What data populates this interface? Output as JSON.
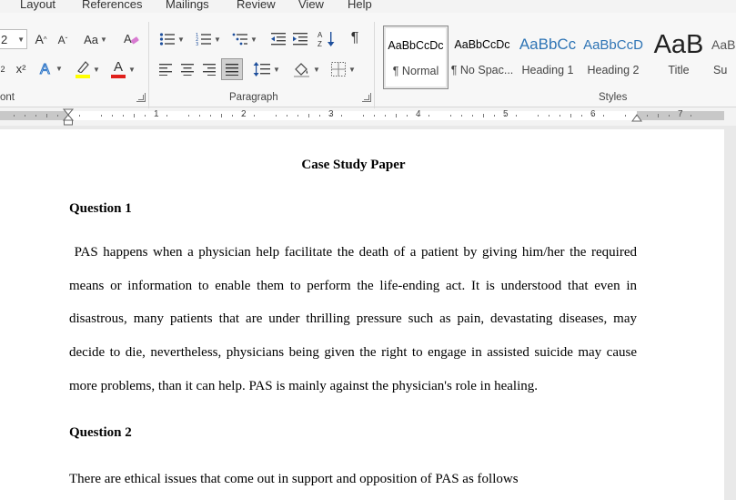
{
  "menu": {
    "tabs": [
      "Layout",
      "References",
      "Mailings",
      "Review",
      "View",
      "Help"
    ]
  },
  "ribbon": {
    "font": {
      "size_value": "2",
      "label": "ont",
      "grow": "A",
      "shrink": "A",
      "change_case": "Aa",
      "subscript": "2",
      "superscript": "x²",
      "font_color_letter": "A",
      "highlight_color": "#ffff00",
      "font_color": "#e0201b"
    },
    "paragraph": {
      "label": "Paragraph",
      "show_marks": "¶"
    },
    "styles": {
      "label": "Styles",
      "items": [
        {
          "sample": "AaBbCcDc",
          "name": "¶ Normal"
        },
        {
          "sample": "AaBbCcDc",
          "name": "¶ No Spac..."
        },
        {
          "sample": "AaBbCc",
          "name": "Heading 1"
        },
        {
          "sample": "AaBbCcD",
          "name": "Heading 2"
        },
        {
          "sample": "AaB",
          "name": "Title"
        },
        {
          "sample": "AaB",
          "name": "Su"
        }
      ]
    }
  },
  "ruler": {
    "numbers": [
      "1",
      "2",
      "3",
      "4",
      "5",
      "6",
      "7"
    ]
  },
  "document": {
    "title": "Case Study Paper",
    "q1_heading": "Question 1",
    "q1_lines": [
      " PAS happens when a physician help facilitate the death of a patient by giving him/her the required",
      "means or information to enable them to perform the life-ending act. It is understood that even in",
      "disastrous, many patients that are under thrilling pressure such as pain, devastating diseases, may",
      "decide to die, nevertheless, physicians being given the right to engage in assisted suicide may cause",
      "more problems, than it can help. PAS is mainly against the physician's role in healing."
    ],
    "q2_heading": "Question 2",
    "q2_lines": [
      "There are ethical issues that come out in support and opposition of PAS as follows"
    ]
  }
}
